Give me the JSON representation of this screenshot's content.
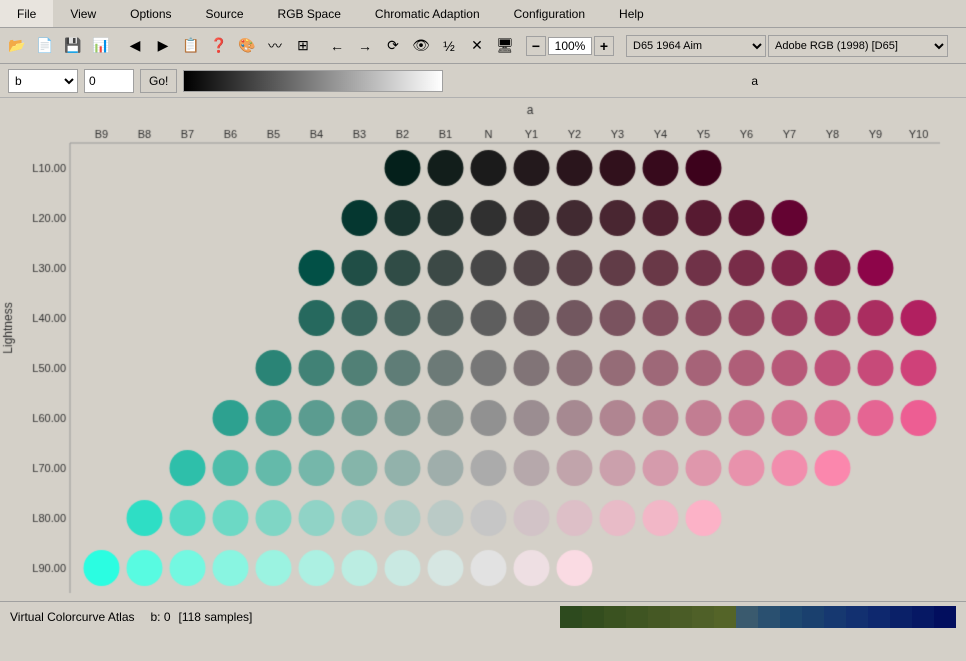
{
  "menubar": {
    "items": [
      "File",
      "View",
      "Options",
      "Source",
      "RGB Space",
      "Chromatic Adaption",
      "Configuration",
      "Help"
    ]
  },
  "toolbar": {
    "zoom": "100%",
    "illuminant": "D65 1964 Aim",
    "colorspace": "Adobe RGB (1998) [D65]"
  },
  "controls": {
    "axis_b": "b",
    "value": "0",
    "go_label": "Go!",
    "a_axis_label": "a"
  },
  "chart": {
    "y_axis_label": "Lightness",
    "col_headers": [
      "B9",
      "B8",
      "B7",
      "B6",
      "B5",
      "B4",
      "B3",
      "B2",
      "B1",
      "N",
      "Y1",
      "Y2",
      "Y3",
      "Y4",
      "Y5",
      "Y6",
      "Y7",
      "Y8",
      "Y9",
      "Y10"
    ],
    "row_labels": [
      "L10.00",
      "L20.00",
      "L30.00",
      "L40.00",
      "L50.00",
      "L60.00",
      "L70.00",
      "L80.00",
      "L90.00"
    ]
  },
  "statusbar": {
    "app_name": "Virtual Colorcurve Atlas",
    "b_value": "b: 0",
    "samples": "[118 samples]"
  },
  "bottom_swatches": [
    "#2d4a1e",
    "#334d1e",
    "#3a5220",
    "#3f5522",
    "#455824",
    "#4a5c26",
    "#4f6028",
    "#546428",
    "#3a5a6e",
    "#2a5070",
    "#1e4870",
    "#1a406e",
    "#163870",
    "#123070",
    "#0e286e",
    "#0a2068",
    "#061864",
    "#020e5e"
  ]
}
